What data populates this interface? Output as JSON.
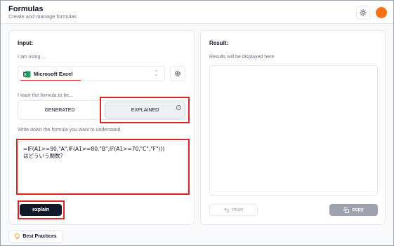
{
  "header": {
    "title": "Formulas",
    "subtitle": "Create and manage formulas"
  },
  "input_panel": {
    "title": "Input:",
    "using_label": "I am using ...",
    "tool_selected": "Microsoft Excel",
    "mode_label": "I want the formula to be...",
    "modes": [
      "GENERATED",
      "EXPLAINED"
    ],
    "selected_mode": "EXPLAINED",
    "formula_label": "Write down the formula you want to understand",
    "formula_line1": "=IF(A1>=90,\"A\",IF(A1>=80,\"B\",IF(A1>=70,\"C\",\"F\")))",
    "formula_line2": "はどういう関数？",
    "submit_label": "explain"
  },
  "result_panel": {
    "title": "Result:",
    "placeholder": "Results will be displayed here",
    "reset_label": "reset",
    "copy_label": "copy"
  },
  "footer": {
    "best_practices_label": "Best Practices"
  },
  "colors": {
    "accent_dark": "#111827",
    "avatar": "#f97316",
    "highlight": "#dc2626",
    "excel_green": "#107c41"
  }
}
